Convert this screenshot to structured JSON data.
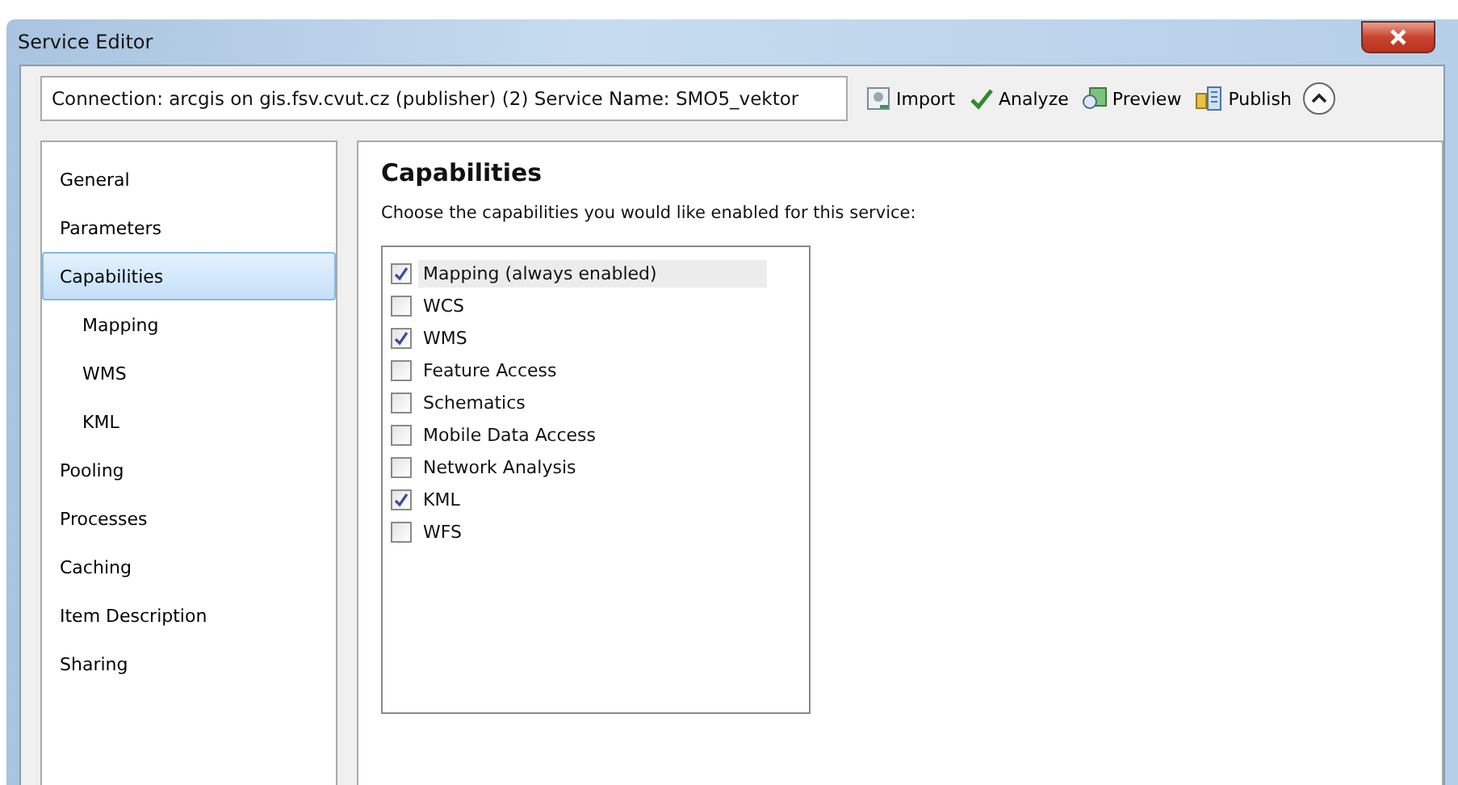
{
  "window": {
    "title": "Service Editor"
  },
  "connection": {
    "text": "Connection: arcgis on gis.fsv.cvut.cz (publisher) (2)  Service Name: SMO5_vektor"
  },
  "toolbar": [
    {
      "label": "Import",
      "kind": "import"
    },
    {
      "label": "Analyze",
      "kind": "analyze"
    },
    {
      "label": "Preview",
      "kind": "preview"
    },
    {
      "label": "Publish",
      "kind": "publish"
    }
  ],
  "sidebar": {
    "items": [
      {
        "label": "General",
        "selected": false
      },
      {
        "label": "Parameters",
        "selected": false
      },
      {
        "label": "Capabilities",
        "selected": true,
        "children": [
          {
            "label": "Mapping",
            "selected": false
          },
          {
            "label": "WMS",
            "selected": false
          },
          {
            "label": "KML",
            "selected": false
          }
        ]
      },
      {
        "label": "Pooling",
        "selected": false
      },
      {
        "label": "Processes",
        "selected": false
      },
      {
        "label": "Caching",
        "selected": false
      },
      {
        "label": "Item Description",
        "selected": false
      },
      {
        "label": "Sharing",
        "selected": false
      }
    ]
  },
  "content": {
    "heading": "Capabilities",
    "instruction": "Choose the capabilities you would like enabled for this service:",
    "capabilities": [
      {
        "label": "Mapping (always enabled)",
        "checked": true,
        "selected": true
      },
      {
        "label": "WCS",
        "checked": false,
        "selected": false
      },
      {
        "label": "WMS",
        "checked": true,
        "selected": false
      },
      {
        "label": "Feature Access",
        "checked": false,
        "selected": false
      },
      {
        "label": "Schematics",
        "checked": false,
        "selected": false
      },
      {
        "label": "Mobile Data Access",
        "checked": false,
        "selected": false
      },
      {
        "label": "Network Analysis",
        "checked": false,
        "selected": false
      },
      {
        "label": "KML",
        "checked": true,
        "selected": false
      },
      {
        "label": "WFS",
        "checked": false,
        "selected": false
      }
    ]
  }
}
